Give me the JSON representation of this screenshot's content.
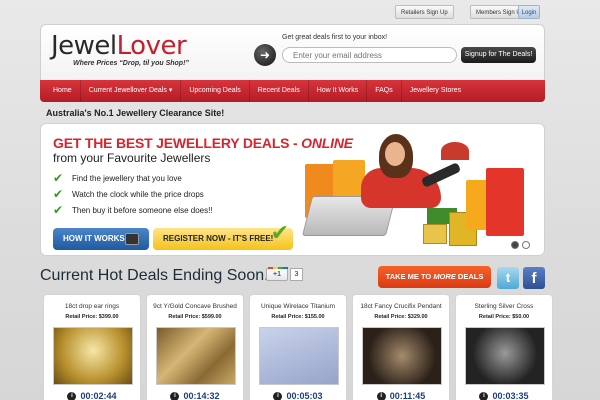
{
  "top_buttons": {
    "retailers": "Retailers Sign Up",
    "members": "Members Sign Up",
    "login": "Login"
  },
  "header": {
    "logo_part1": "Jewel",
    "logo_part2": "Lover",
    "tagline": "Where Prices “Drop, til you Shop!”",
    "signup_prompt": "Get great deals first to your inbox!",
    "email_placeholder": "Enter your email address",
    "signup_button": "Signup for The Deals!"
  },
  "nav": [
    "Home",
    "Current Jewellover Deals ▾",
    "Upcoming Deals",
    "Recent Deals",
    "How It Works",
    "FAQs",
    "Jewellery Stores"
  ],
  "clearance_text": "Australia's No.1 Jewellery Clearance Site!",
  "hero": {
    "title_main": "GET THE BEST JEWELLERY DEALS - ",
    "title_em": "ONLINE",
    "subtitle": "from your Favourite Jewellers",
    "bullets": [
      "Find the jewellery that you love",
      "Watch the clock while the price drops",
      "Then buy it before someone else does!!"
    ],
    "how_button": "HOW IT WORKS",
    "register_button": "REGISTER NOW - IT'S FREE!"
  },
  "deals_section": {
    "title": "Current Hot Deals Ending Soon...",
    "plus_one": "+1",
    "plus_count": "3",
    "more_deals_a": "TAKE ME TO ",
    "more_deals_b": "MORE",
    "more_deals_c": " DEALS"
  },
  "deals": [
    {
      "name": "18ct drop ear rings",
      "price": "Retail Price: $399.00",
      "timer": "00:02:44"
    },
    {
      "name": "9ct Y/Gold Concave Brushed",
      "price": "Retail Price: $599.00",
      "timer": "00:14:32"
    },
    {
      "name": "Unique Wirelace Titanium",
      "price": "Retail Price: $155.00",
      "timer": "00:05:03"
    },
    {
      "name": "18ct Fancy Crucifix Pendant",
      "price": "Retail Price: $329.00",
      "timer": "00:11:45"
    },
    {
      "name": "Sterling Silver Cross",
      "price": "Retail Price: $50.00",
      "timer": "00:03:35"
    }
  ],
  "icons": {
    "arrow": "right-arrow-icon",
    "check": "checkmark-icon",
    "info": "info-icon",
    "twitter": "twitter-icon",
    "facebook": "facebook-icon"
  },
  "colors": {
    "brand_red": "#c2222e",
    "nav_red": "#c4262f",
    "timer_blue": "#1d3f7a",
    "more_orange": "#e8481d"
  }
}
